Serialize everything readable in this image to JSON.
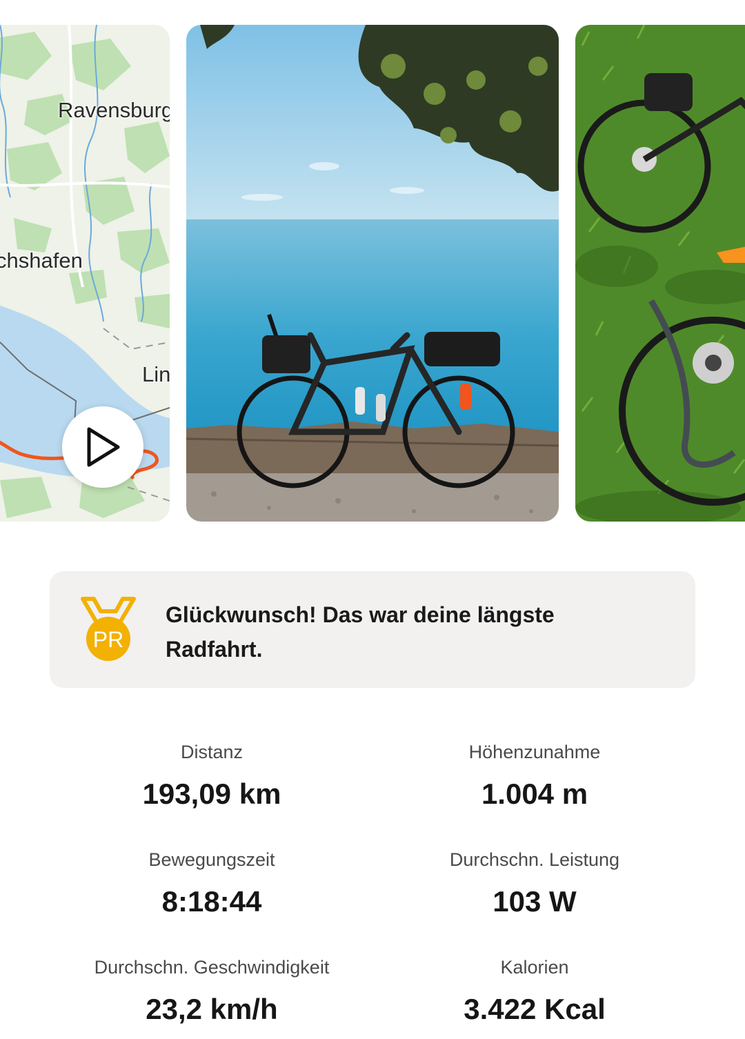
{
  "media": {
    "map": {
      "labels": {
        "ravensburg": "Ravensburg",
        "friedrichshafen": "chshafen",
        "lindau": "Lin"
      },
      "route_color": "#f0561d"
    },
    "photos": [
      "bike-by-lake-photo",
      "bike-on-grass-photo"
    ]
  },
  "achievement": {
    "badge_text": "PR",
    "badge_color": "#f2b103",
    "message": "Glückwunsch! Das war deine längste Radfahrt."
  },
  "stats": {
    "distance": {
      "label": "Distanz",
      "value": "193,09 km"
    },
    "elevation": {
      "label": "Höhenzunahme",
      "value": "1.004 m"
    },
    "moving_time": {
      "label": "Bewegungszeit",
      "value": "8:18:44"
    },
    "avg_power": {
      "label": "Durchschn. Leistung",
      "value": "103 W"
    },
    "avg_speed": {
      "label": "Durchschn. Geschwindigkeit",
      "value": "23,2 km/h"
    },
    "calories": {
      "label": "Kalorien",
      "value": "3.422 Kcal"
    }
  }
}
